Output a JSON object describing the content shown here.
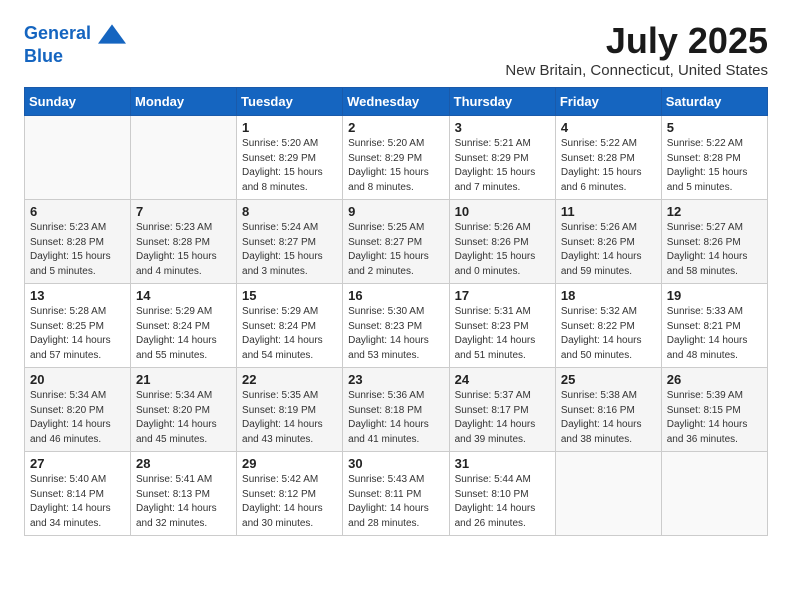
{
  "header": {
    "logo_line1": "General",
    "logo_line2": "Blue",
    "month": "July 2025",
    "location": "New Britain, Connecticut, United States"
  },
  "weekdays": [
    "Sunday",
    "Monday",
    "Tuesday",
    "Wednesday",
    "Thursday",
    "Friday",
    "Saturday"
  ],
  "weeks": [
    [
      {
        "day": "",
        "info": ""
      },
      {
        "day": "",
        "info": ""
      },
      {
        "day": "1",
        "info": "Sunrise: 5:20 AM\nSunset: 8:29 PM\nDaylight: 15 hours\nand 8 minutes."
      },
      {
        "day": "2",
        "info": "Sunrise: 5:20 AM\nSunset: 8:29 PM\nDaylight: 15 hours\nand 8 minutes."
      },
      {
        "day": "3",
        "info": "Sunrise: 5:21 AM\nSunset: 8:29 PM\nDaylight: 15 hours\nand 7 minutes."
      },
      {
        "day": "4",
        "info": "Sunrise: 5:22 AM\nSunset: 8:28 PM\nDaylight: 15 hours\nand 6 minutes."
      },
      {
        "day": "5",
        "info": "Sunrise: 5:22 AM\nSunset: 8:28 PM\nDaylight: 15 hours\nand 5 minutes."
      }
    ],
    [
      {
        "day": "6",
        "info": "Sunrise: 5:23 AM\nSunset: 8:28 PM\nDaylight: 15 hours\nand 5 minutes."
      },
      {
        "day": "7",
        "info": "Sunrise: 5:23 AM\nSunset: 8:28 PM\nDaylight: 15 hours\nand 4 minutes."
      },
      {
        "day": "8",
        "info": "Sunrise: 5:24 AM\nSunset: 8:27 PM\nDaylight: 15 hours\nand 3 minutes."
      },
      {
        "day": "9",
        "info": "Sunrise: 5:25 AM\nSunset: 8:27 PM\nDaylight: 15 hours\nand 2 minutes."
      },
      {
        "day": "10",
        "info": "Sunrise: 5:26 AM\nSunset: 8:26 PM\nDaylight: 15 hours\nand 0 minutes."
      },
      {
        "day": "11",
        "info": "Sunrise: 5:26 AM\nSunset: 8:26 PM\nDaylight: 14 hours\nand 59 minutes."
      },
      {
        "day": "12",
        "info": "Sunrise: 5:27 AM\nSunset: 8:26 PM\nDaylight: 14 hours\nand 58 minutes."
      }
    ],
    [
      {
        "day": "13",
        "info": "Sunrise: 5:28 AM\nSunset: 8:25 PM\nDaylight: 14 hours\nand 57 minutes."
      },
      {
        "day": "14",
        "info": "Sunrise: 5:29 AM\nSunset: 8:24 PM\nDaylight: 14 hours\nand 55 minutes."
      },
      {
        "day": "15",
        "info": "Sunrise: 5:29 AM\nSunset: 8:24 PM\nDaylight: 14 hours\nand 54 minutes."
      },
      {
        "day": "16",
        "info": "Sunrise: 5:30 AM\nSunset: 8:23 PM\nDaylight: 14 hours\nand 53 minutes."
      },
      {
        "day": "17",
        "info": "Sunrise: 5:31 AM\nSunset: 8:23 PM\nDaylight: 14 hours\nand 51 minutes."
      },
      {
        "day": "18",
        "info": "Sunrise: 5:32 AM\nSunset: 8:22 PM\nDaylight: 14 hours\nand 50 minutes."
      },
      {
        "day": "19",
        "info": "Sunrise: 5:33 AM\nSunset: 8:21 PM\nDaylight: 14 hours\nand 48 minutes."
      }
    ],
    [
      {
        "day": "20",
        "info": "Sunrise: 5:34 AM\nSunset: 8:20 PM\nDaylight: 14 hours\nand 46 minutes."
      },
      {
        "day": "21",
        "info": "Sunrise: 5:34 AM\nSunset: 8:20 PM\nDaylight: 14 hours\nand 45 minutes."
      },
      {
        "day": "22",
        "info": "Sunrise: 5:35 AM\nSunset: 8:19 PM\nDaylight: 14 hours\nand 43 minutes."
      },
      {
        "day": "23",
        "info": "Sunrise: 5:36 AM\nSunset: 8:18 PM\nDaylight: 14 hours\nand 41 minutes."
      },
      {
        "day": "24",
        "info": "Sunrise: 5:37 AM\nSunset: 8:17 PM\nDaylight: 14 hours\nand 39 minutes."
      },
      {
        "day": "25",
        "info": "Sunrise: 5:38 AM\nSunset: 8:16 PM\nDaylight: 14 hours\nand 38 minutes."
      },
      {
        "day": "26",
        "info": "Sunrise: 5:39 AM\nSunset: 8:15 PM\nDaylight: 14 hours\nand 36 minutes."
      }
    ],
    [
      {
        "day": "27",
        "info": "Sunrise: 5:40 AM\nSunset: 8:14 PM\nDaylight: 14 hours\nand 34 minutes."
      },
      {
        "day": "28",
        "info": "Sunrise: 5:41 AM\nSunset: 8:13 PM\nDaylight: 14 hours\nand 32 minutes."
      },
      {
        "day": "29",
        "info": "Sunrise: 5:42 AM\nSunset: 8:12 PM\nDaylight: 14 hours\nand 30 minutes."
      },
      {
        "day": "30",
        "info": "Sunrise: 5:43 AM\nSunset: 8:11 PM\nDaylight: 14 hours\nand 28 minutes."
      },
      {
        "day": "31",
        "info": "Sunrise: 5:44 AM\nSunset: 8:10 PM\nDaylight: 14 hours\nand 26 minutes."
      },
      {
        "day": "",
        "info": ""
      },
      {
        "day": "",
        "info": ""
      }
    ]
  ]
}
